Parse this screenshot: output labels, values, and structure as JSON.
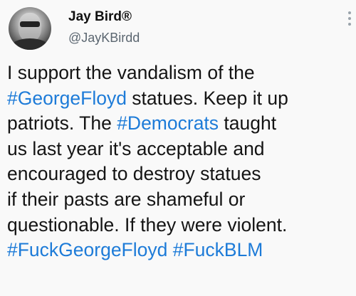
{
  "tweet": {
    "display_name": "Jay Bird®",
    "handle": "@JayKBirdd",
    "lines": [
      [
        {
          "text": "I support the vandalism of the",
          "tag": false
        }
      ],
      [
        {
          "text": "#GeorgeFloyd",
          "tag": true
        },
        {
          "text": " statues. Keep it up",
          "tag": false
        }
      ],
      [
        {
          "text": "patriots. The ",
          "tag": false
        },
        {
          "text": "#Democrats",
          "tag": true
        },
        {
          "text": " taught",
          "tag": false
        }
      ],
      [
        {
          "text": "us last year it's acceptable and",
          "tag": false
        }
      ],
      [
        {
          "text": "encouraged to destroy statues",
          "tag": false
        }
      ],
      [
        {
          "text": "if their pasts are shameful or",
          "tag": false
        }
      ],
      [
        {
          "text": "questionable.  If they were violent.",
          "tag": false
        }
      ],
      [
        {
          "text": "#FuckGeorgeFloyd",
          "tag": true
        },
        {
          "text": " ",
          "tag": false
        },
        {
          "text": "#FuckBLM",
          "tag": true
        }
      ]
    ]
  },
  "icons": {
    "avatar": "profile-photo",
    "more": "vertical-ellipsis-icon"
  },
  "colors": {
    "hashtag": "#1d7bd8",
    "text": "#141414",
    "handle": "#5b6670"
  }
}
